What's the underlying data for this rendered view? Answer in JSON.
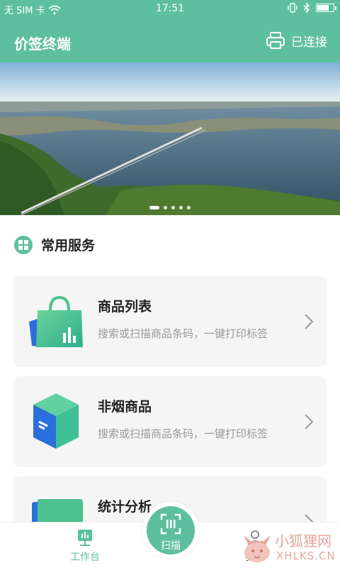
{
  "status_bar": {
    "carrier": "无 SIM 卡",
    "time": "17:51",
    "battery_level": 0.75
  },
  "header": {
    "title": "价签终端",
    "connection_label": "已连接",
    "printer_icon": "printer-icon"
  },
  "banner": {
    "slide_count": 5,
    "active_index": 0
  },
  "services": {
    "title": "常用服务",
    "items": [
      {
        "name": "商品列表",
        "desc": "搜索或扫描商品条码，一键打印标签",
        "icon": "shopping-bag-icon"
      },
      {
        "name": "非烟商品",
        "desc": "搜索或扫描商品条码，一键打印标签",
        "icon": "box-icon"
      },
      {
        "name": "统计分析",
        "desc": "",
        "icon": "analytics-icon"
      }
    ]
  },
  "bottom_nav": {
    "workbench": "工作台",
    "scan": "扫描",
    "mine": "我的"
  },
  "watermark": {
    "cn": "小狐狸网",
    "en": "XHLKS.CN"
  },
  "colors": {
    "primary": "#5dbf9f",
    "card_bg": "#f5f5f5",
    "text_dark": "#222222",
    "text_muted": "#999999"
  }
}
